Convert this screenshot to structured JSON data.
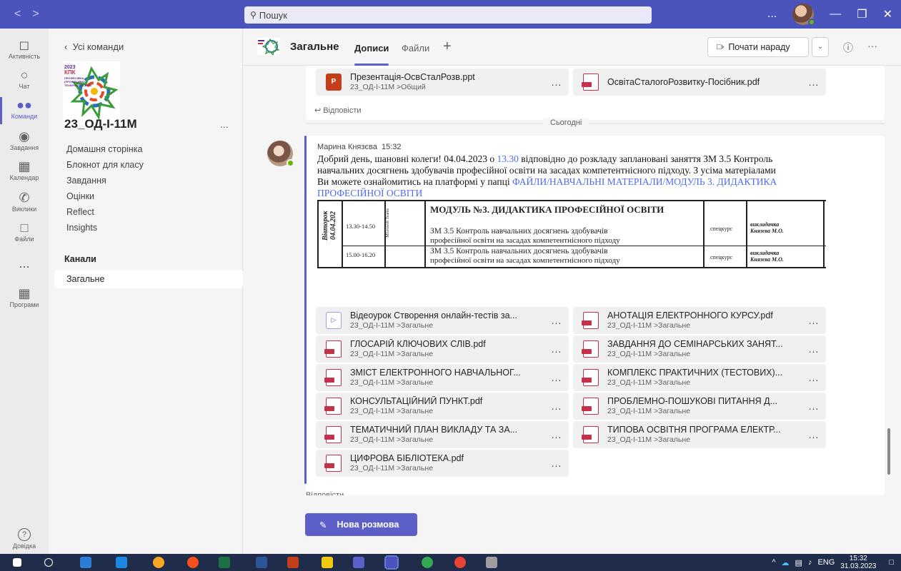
{
  "titlebar": {
    "nav_back": "<",
    "nav_forward": ">",
    "search_placeholder": "Пошук",
    "more": "...",
    "minimize": "—",
    "maximize": "❐",
    "close": "✕"
  },
  "rail": {
    "activity": "Активність",
    "chat": "Чат",
    "teams": "Команди",
    "assignments": "Завдання",
    "calendar": "Календар",
    "calls": "Виклики",
    "files": "Файли",
    "more": "...",
    "apps": "Програми",
    "help": "Довідка"
  },
  "team_panel": {
    "back_label": "Усі команди",
    "team_name": "23_ОД-І-11М",
    "team_more": "...",
    "nav_items": [
      "Домашня сторінка",
      "Блокнот для класу",
      "Завдання",
      "Оцінки",
      "Reflect",
      "Insights"
    ],
    "channels_header": "Канали",
    "selected_channel": "Загальне",
    "logo_text": [
      "2023",
      "КПК",
      "ПРОФЕСІЙНА",
      "(ПРОФЕСІЙНО-",
      "ТЕХНІЧНА) ОСВІТА"
    ]
  },
  "channel_header": {
    "title": "Загальне",
    "tab_posts": "Дописи",
    "tab_files": "Файли",
    "add": "+",
    "meet_button": "Почати нараду",
    "meet_dropdown": "⌄",
    "info": "ⓘ",
    "more": "···"
  },
  "previous_post": {
    "files": [
      {
        "name": "Презентація-ОсвСталРозв.ppt",
        "path": "23_ОД-І-11М >Общий",
        "type": "ppt"
      },
      {
        "name": "ОсвітаСталогоРозвитку-Посібник.pdf",
        "path": "",
        "type": "pdf"
      }
    ],
    "reply": "Відповісти"
  },
  "divider_label": "Сьогодні",
  "message": {
    "author": "Марина Князєва",
    "time": "15:32",
    "body_1": "Добрий день, шановні колеги! 04.04.2023 о ",
    "body_time": "13.30",
    "body_2": " відповідно до розкладу заплановані заняття ЗМ 3.5 Контроль навчальних досягнень здобувачів професійної освіти на засадах компетентнісного підходу. З усіма матеріалами Ви можете ознайомитись на платформі у папці ",
    "body_link": "ФАЙЛИ/НАВЧАЛЬНІ МАТЕРІАЛИ/МОДУЛЬ 3. ДИДАКТИКА ПРОФЕСІЙНОЇ ОСВІТИ"
  },
  "schedule": {
    "day": "Вівторок",
    "date": "04.04.202",
    "small": "Microsoft Teams",
    "module": "МОДУЛЬ №3. ДИДАКТИКА ПРОФЕСІЙНОЇ ОСВІТИ",
    "rows": [
      {
        "time": "13.30-14.50",
        "line1": "ЗМ 3.5 Контроль навчальних досягнень здобувачів",
        "line2": "професійної освіти на засадах компетентнісного підходу",
        "type": "спецкурс",
        "lecturer1": "викладачка",
        "lecturer2": "Князєва М.О."
      },
      {
        "time": "15.00-16.20",
        "line1": "ЗМ 3.5 Контроль навчальних досягнень здобувачів",
        "line2": "професійної освіти на засадах компетентнісного підходу",
        "type": "спецкурс",
        "lecturer1": "викладачка",
        "lecturer2": "Князєва М.О."
      }
    ]
  },
  "attachments": [
    {
      "name": "Відеоурок Створення онлайн-тестів за...",
      "path": "23_ОД-І-11М >Загальне",
      "type": "video"
    },
    {
      "name": "АНОТАЦІЯ ЕЛЕКТРОННОГО КУРСУ.pdf",
      "path": "23_ОД-І-11М >Загальне",
      "type": "pdf"
    },
    {
      "name": "ГЛОСАРІЙ КЛЮЧОВИХ СЛІВ.pdf",
      "path": "23_ОД-І-11М >Загальне",
      "type": "pdf"
    },
    {
      "name": "ЗАВДАННЯ ДО СЕМІНАРСЬКИХ ЗАНЯТ...",
      "path": "23_ОД-І-11М >Загальне",
      "type": "pdf"
    },
    {
      "name": "ЗМІСТ ЕЛЕКТРОННОГО НАВЧАЛЬНОГ...",
      "path": "23_ОД-І-11М >Загальне",
      "type": "pdf"
    },
    {
      "name": "КОМПЛЕКС ПРАКТИЧНИХ (ТЕСТОВИХ)...",
      "path": "23_ОД-І-11М >Загальне",
      "type": "pdf"
    },
    {
      "name": "КОНСУЛЬТАЦІЙНИЙ ПУНКТ.pdf",
      "path": "23_ОД-І-11М >Загальне",
      "type": "pdf"
    },
    {
      "name": "ПРОБЛЕМНО-ПОШУКОВІ ПИТАННЯ Д...",
      "path": "23_ОД-І-11М >Загальне",
      "type": "pdf"
    },
    {
      "name": "ТЕМАТИЧНИЙ ПЛАН ВИКЛАДУ ТА ЗА...",
      "path": "23_ОД-І-11М >Загальне",
      "type": "pdf"
    },
    {
      "name": "ТИПОВА ОСВІТНЯ ПРОГРАМА ЕЛЕКТР...",
      "path": "23_ОД-І-11М >Загальне",
      "type": "pdf"
    },
    {
      "name": "ЦИФРОВА БІБЛІОТЕКА.pdf",
      "path": "23_ОД-І-11М >Загальне",
      "type": "pdf"
    }
  ],
  "file_more": "...",
  "reply_partial": "Відповісти",
  "new_conversation": "Нова розмова",
  "taskbar": {
    "language": "ENG",
    "time": "15:32",
    "date": "31.03.2023"
  },
  "colors": {
    "accent": "#5b5fc7",
    "titlebar": "#4b53bc",
    "pdf": "#c4314b",
    "ppt": "#c43e1c"
  }
}
